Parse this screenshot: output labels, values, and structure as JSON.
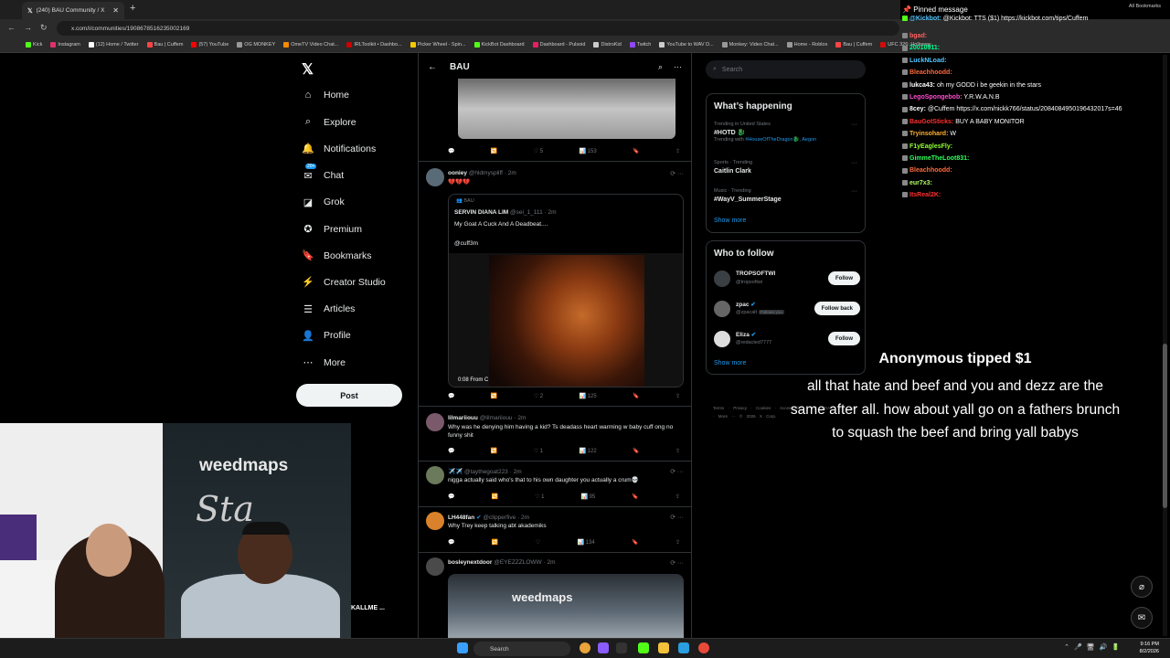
{
  "browser": {
    "tab_title": "(240) BAU Community / X",
    "url": "x.com/i/communities/1908678516235002169",
    "bookmarks": [
      "Kick",
      "Instagram",
      "(12) Home / Twitter",
      "Bau | Cuffem",
      "(57) YouTube",
      "OG MONKEY",
      "OmeTV Video Chat...",
      "IRLToolkit • Dashbo...",
      "Picker Wheel - Spin...",
      "KickBot Dashboard",
      "Dashboard - Pulsoid",
      "DistroKid",
      "Twitch",
      "YouTube to WAV D...",
      "Monkey: Video Chat...",
      "Home - Roblox",
      "Bau | Cuffem",
      "UFC 326: Holloway..."
    ],
    "all_bookmarks": "All Bookmarks"
  },
  "nav": {
    "items": [
      {
        "label": "Home",
        "icon": "home-icon"
      },
      {
        "label": "Explore",
        "icon": "search-icon"
      },
      {
        "label": "Notifications",
        "icon": "bell-icon"
      },
      {
        "label": "Chat",
        "icon": "chat-icon"
      },
      {
        "label": "Grok",
        "icon": "grok-icon"
      },
      {
        "label": "Premium",
        "icon": "premium-icon"
      },
      {
        "label": "Bookmarks",
        "icon": "bookmark-icon"
      },
      {
        "label": "Creator Studio",
        "icon": "lightning-icon"
      },
      {
        "label": "Articles",
        "icon": "article-icon"
      },
      {
        "label": "Profile",
        "icon": "person-icon"
      },
      {
        "label": "More",
        "icon": "more-circle-icon"
      }
    ],
    "chat_badge": "20+",
    "post_label": "Post",
    "account_name": "KALLME ..."
  },
  "timeline": {
    "header_title": "BAU",
    "first_actions": {
      "likes": "5",
      "views": "153"
    },
    "posts": [
      {
        "name": "ooniey",
        "handle": "@hldmyspliff",
        "time": "· 2m",
        "text": "💔💔💔",
        "quote": {
          "community": "BAU",
          "name": "SERVIN DIANA LIM",
          "handle": "@sei_1_111",
          "time": "· 2m",
          "line1": "My Goat A Cuck And A Deadbeat....",
          "line2": "@cuff3m",
          "video_time": "0:08",
          "video_from": "From",
          "video_source": "C"
        },
        "likes": "2",
        "views": "125"
      },
      {
        "name": "lilmariiouu",
        "handle": "@lilmariiouu",
        "time": "· 2m",
        "text": "Why was he denying him having a kid? Ts deadass heart warming w baby cuff ong no funny shit",
        "likes": "1",
        "views": "122"
      },
      {
        "name": "✈️✈️",
        "handle": "@taythegoat223",
        "time": "· 2m",
        "text": "nigga actually said who's that to his own daughter you actually a crum💀",
        "likes": "1",
        "views": "95"
      },
      {
        "name": "LH448fan",
        "handle": "@clipperfive",
        "time": "· 2m",
        "text": "Why Trey keep talking abt akademiks",
        "likes": "",
        "views": "134"
      },
      {
        "name": "bosleynextdoor",
        "handle": "@EYEZZZLOWW",
        "time": "· 2m",
        "text": "",
        "media_text": "weedmaps"
      }
    ]
  },
  "sidebar": {
    "search_placeholder": "Search",
    "happening_title": "What’s happening",
    "trends": [
      {
        "context": "Trending in United States",
        "name": "#HOTD 🐉",
        "extra_prefix": "Trending with",
        "extra": "#HouseOfTheDragon🐉, Aegon"
      },
      {
        "context": "Sports · Trending",
        "name": "Caitlin Clark",
        "extra_prefix": "",
        "extra": ""
      },
      {
        "context": "Music · Trending",
        "name": "#WayV_SummerStage",
        "extra_prefix": "",
        "extra": ""
      }
    ],
    "show_more": "Show more",
    "wtf_title": "Who to follow",
    "follow": [
      {
        "name": "TROPSOFTWI",
        "handle": "@tropsoftwi",
        "button": "Follow",
        "follows_you": ""
      },
      {
        "name": "zpac",
        "handle": "@zpacalt",
        "button": "Follow back",
        "follows_you": "Follows you"
      },
      {
        "name": "Eliza",
        "handle": "@redacted7777",
        "button": "Follow",
        "follows_you": ""
      }
    ],
    "footer": "Terms · Privacy · Cookies · Accessibility · US TIDA · Ads info · More ··· © 2026 X Corp."
  },
  "chat": {
    "header_partial": "...",
    "pinned_label": "Pinned message",
    "pinned_text": "@Kickbot: TTS ($1) https://kickbot.com/tips/Cuffem",
    "lines": [
      {
        "user": "bgad:",
        "msg": "",
        "color": "#ff5f5f"
      },
      {
        "user": "20010911:",
        "msg": "",
        "color": "#00ff90"
      },
      {
        "user": "LuckNLoad:",
        "msg": "",
        "color": "#53c7ff"
      },
      {
        "user": "Bleachhoodd:",
        "msg": "",
        "color": "#ff6a3d"
      },
      {
        "user": "lukca43:",
        "msg": "oh my GODD i be geekin in the stars",
        "color": "#ffffff"
      },
      {
        "user": "LegoSpongebob:",
        "msg": "Y.R.W.A.N.B",
        "color": "#ff4dd2"
      },
      {
        "user": "8cey:",
        "msg": "@Cuffem https://x.com/nickk766/status/2084084950196432017s=46",
        "color": "#ffffff"
      },
      {
        "user": "BauGotSticks:",
        "msg": "BUY A BABY MONITOR",
        "color": "#ff3030"
      },
      {
        "user": "Tryinsohard:",
        "msg": "W",
        "color": "#ffb030"
      },
      {
        "user": "F1yEaglesFly:",
        "msg": "",
        "color": "#90ff30"
      },
      {
        "user": "GimmeTheLoot831:",
        "msg": "",
        "color": "#30ff60"
      },
      {
        "user": "Bleachhoodd:",
        "msg": "",
        "color": "#ff6a3d"
      },
      {
        "user": "eur7x3:",
        "msg": "",
        "color": "#b0ff60"
      },
      {
        "user": "ItsReal2K:",
        "msg": "",
        "color": "#ff3030"
      }
    ]
  },
  "tip": {
    "title": "Anonymous tipped $1",
    "message": "all that hate and beef and you and dezz are the same after all. how about yall go on a fathers brunch to squash the beef and bring yall babys"
  },
  "webcam": {
    "banner": "weedmaps",
    "sign": "Sta"
  },
  "taskbar": {
    "search": "Search",
    "time": "9:16 PM",
    "date": "8/2/2026"
  }
}
